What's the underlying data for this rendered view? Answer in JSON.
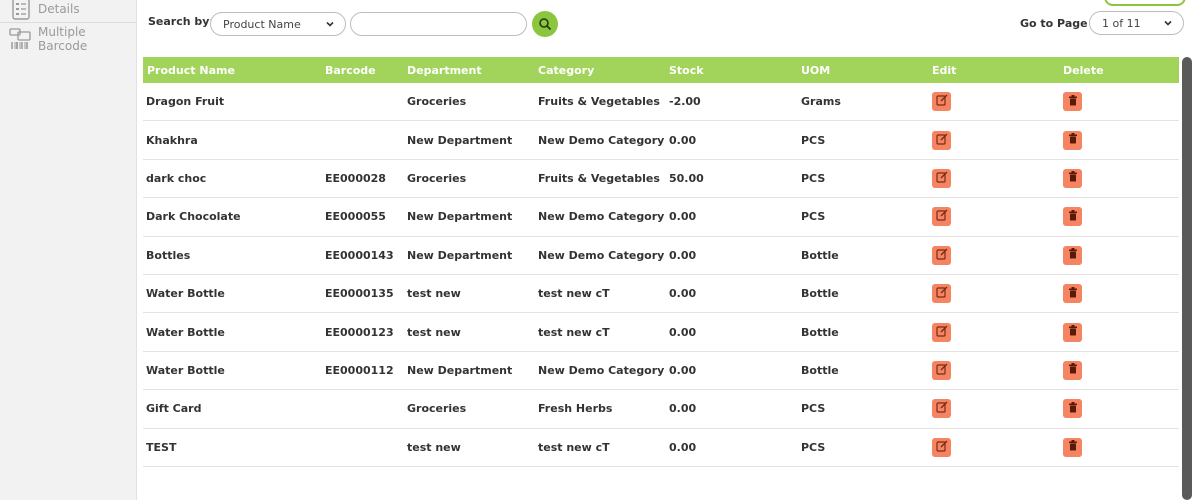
{
  "sidebar": {
    "items": [
      {
        "label": "Details",
        "icon": "document-list-icon"
      },
      {
        "label": "Multiple Barcode",
        "icon": "barcode-scanner-icon"
      }
    ]
  },
  "search": {
    "label": "Search by:",
    "field_selected": "Product Name",
    "query_value": "",
    "button_icon": "search-icon"
  },
  "pagination": {
    "label": "Go to Page",
    "selected": "1 of 11"
  },
  "table": {
    "headers": {
      "name": "Product Name",
      "barcode": "Barcode",
      "department": "Department",
      "category": "Category",
      "stock": "Stock",
      "uom": "UOM",
      "edit": "Edit",
      "delete": "Delete"
    },
    "rows": [
      {
        "name": "Dragon Fruit",
        "barcode": "",
        "department": "Groceries",
        "category": "Fruits & Vegetables",
        "stock": "-2.00",
        "uom": "Grams"
      },
      {
        "name": "Khakhra",
        "barcode": "",
        "department": "New Department",
        "category": "New Demo Category",
        "stock": "0.00",
        "uom": "PCS"
      },
      {
        "name": "dark choc",
        "barcode": "EE000028",
        "department": "Groceries",
        "category": "Fruits & Vegetables",
        "stock": "50.00",
        "uom": "PCS"
      },
      {
        "name": "Dark Chocolate",
        "barcode": "EE000055",
        "department": "New Department",
        "category": "New Demo Category",
        "stock": "0.00",
        "uom": "PCS"
      },
      {
        "name": "Bottles",
        "barcode": "EE0000143",
        "department": "New Department",
        "category": "New Demo Category",
        "stock": "0.00",
        "uom": "Bottle"
      },
      {
        "name": "Water Bottle",
        "barcode": "EE0000135",
        "department": "test new",
        "category": "test new cT",
        "stock": "0.00",
        "uom": "Bottle"
      },
      {
        "name": "Water Bottle",
        "barcode": "EE0000123",
        "department": "test new",
        "category": "test new cT",
        "stock": "0.00",
        "uom": "Bottle"
      },
      {
        "name": "Water Bottle",
        "barcode": "EE0000112",
        "department": "New Department",
        "category": "New Demo Category",
        "stock": "0.00",
        "uom": "Bottle"
      },
      {
        "name": "Gift Card",
        "barcode": "",
        "department": "Groceries",
        "category": "Fresh Herbs",
        "stock": "0.00",
        "uom": "PCS"
      },
      {
        "name": "TEST",
        "barcode": "",
        "department": "test new",
        "category": "test new cT",
        "stock": "0.00",
        "uom": "PCS"
      }
    ]
  },
  "colors": {
    "header_green": "#a2d45b",
    "button_green": "#8cc63f",
    "action_orange": "#f58462"
  }
}
